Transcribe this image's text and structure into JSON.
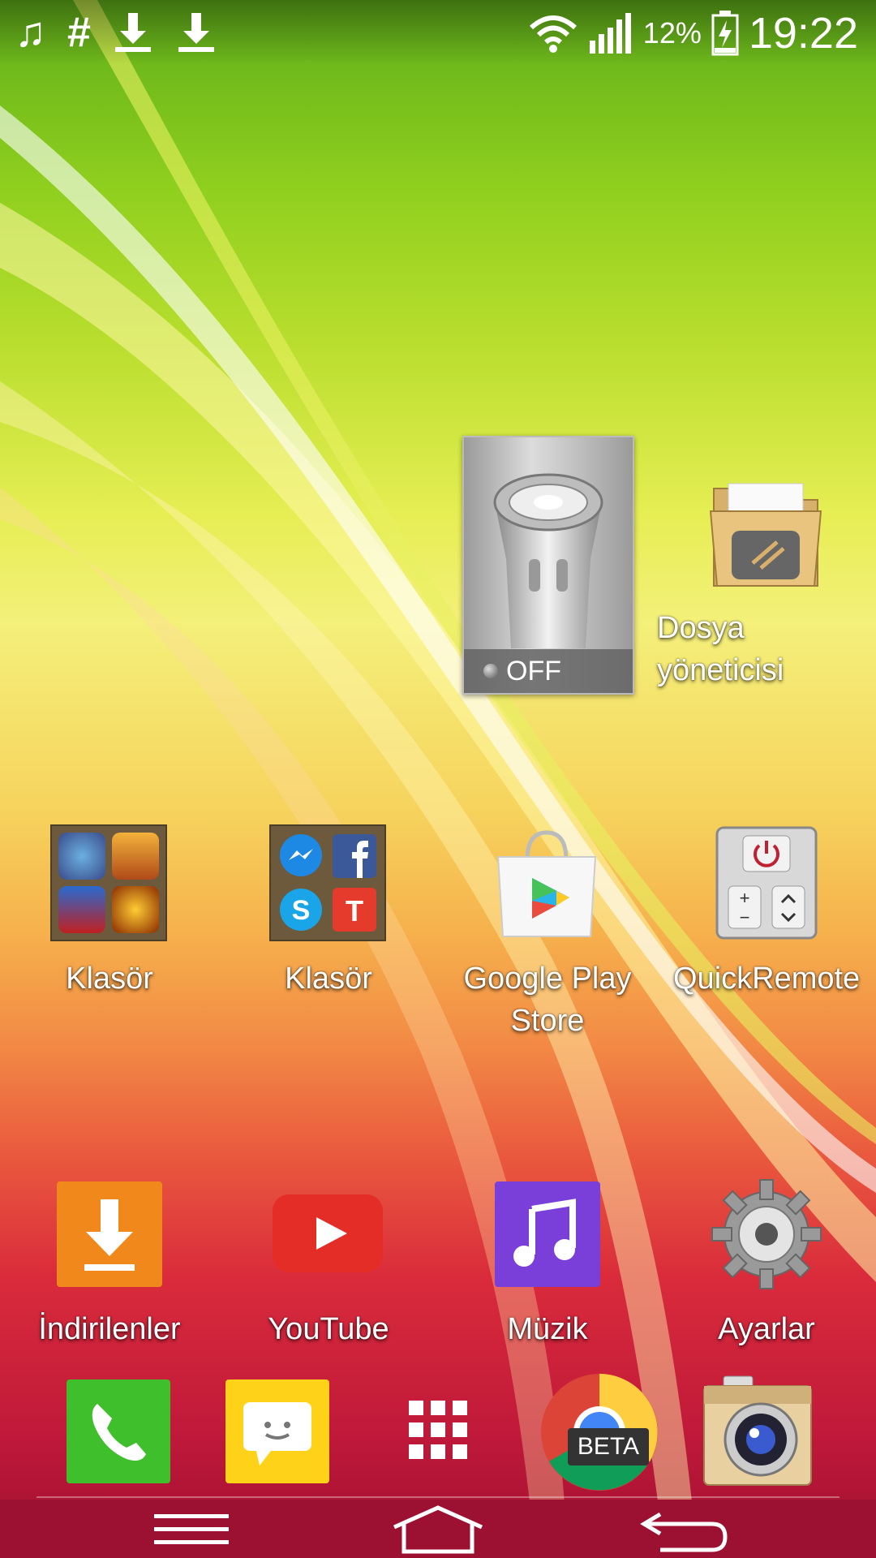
{
  "status_bar": {
    "notification_icons": [
      "music-note-icon",
      "hashtag-icon",
      "download-icon",
      "download-icon"
    ],
    "music_glyph": "♫",
    "hash_glyph": "#",
    "battery": "12%",
    "time": "19:22"
  },
  "widgets": {
    "flashlight": {
      "state": "OFF"
    }
  },
  "home": {
    "file_manager": {
      "label": "Dosya yöneticisi"
    },
    "folder1": {
      "label": "Klasör"
    },
    "folder2": {
      "label": "Klasör"
    },
    "play_store": {
      "label_line1": "Google Play",
      "label_line2": "Store"
    },
    "quickremote": {
      "label": "QuickRemote"
    },
    "downloads": {
      "label": "İndirilenler"
    },
    "youtube": {
      "label": "YouTube"
    },
    "music": {
      "label": "Müzik"
    },
    "settings": {
      "label": "Ayarlar"
    }
  },
  "dock": {
    "chrome_badge": "BETA",
    "items": [
      "phone-icon",
      "messaging-icon",
      "app-drawer-icon",
      "chrome-beta-icon",
      "camera-icon"
    ]
  },
  "colors": {
    "accent_green": "#5fae1a",
    "accent_red": "#c0193a",
    "youtube_red": "#e52d27",
    "downloads_orange": "#f0881c",
    "music_purple": "#7a3fd9"
  }
}
